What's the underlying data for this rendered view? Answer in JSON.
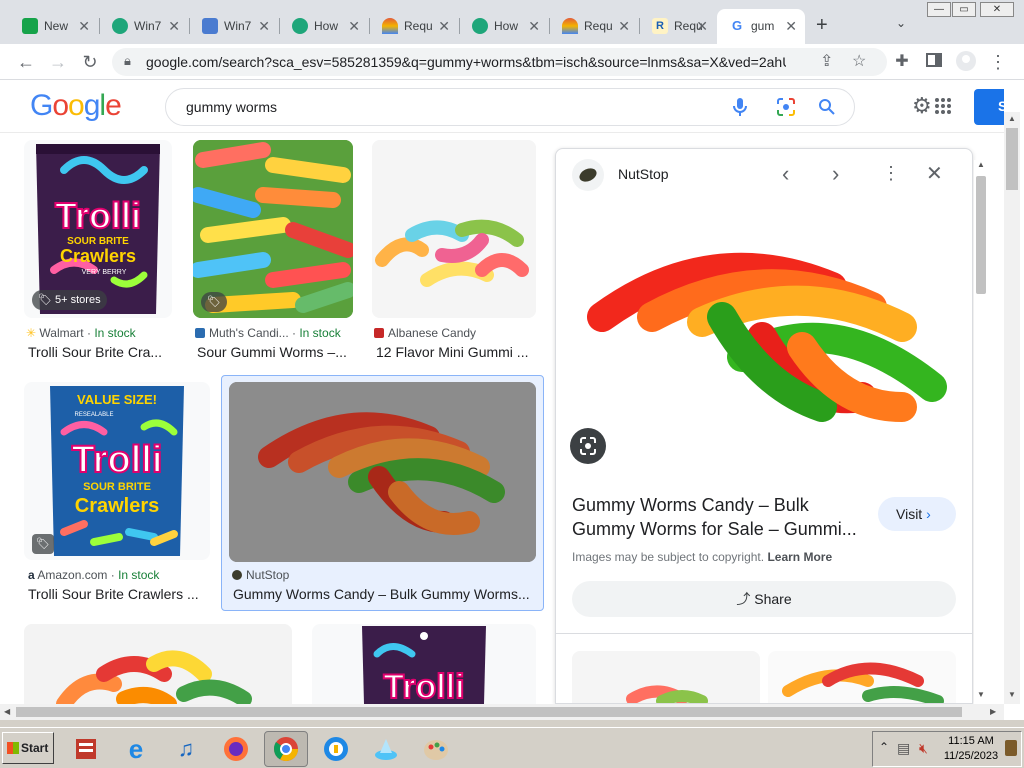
{
  "browser": {
    "tabs": [
      {
        "title": "New",
        "favicon_color": "#16a34a"
      },
      {
        "title": "Win7",
        "favicon_color": "#1ea67a"
      },
      {
        "title": "Win7",
        "favicon_color": "#4a7bd0"
      },
      {
        "title": "How",
        "favicon_color": "#1ea67a"
      },
      {
        "title": "Requ",
        "favicon_color": "#e25b3b"
      },
      {
        "title": "How",
        "favicon_color": "#1ea67a"
      },
      {
        "title": "Requ",
        "favicon_color": "#e25b3b"
      },
      {
        "title": "Requ",
        "favicon_color": "#f4b400"
      },
      {
        "title": "gum",
        "favicon_color": "#4285f4"
      }
    ],
    "new_tab": "+",
    "url": "google.com/search?sca_esv=585281359&q=gummy+worms&tbm=isch&source=lnms&sa=X&ved=2ahU...",
    "window_controls": {
      "minimize": "—",
      "maximize": "▭",
      "close": "✕"
    }
  },
  "google": {
    "query": "gummy worms",
    "sign_in_label": "S"
  },
  "results": [
    {
      "source": "Walmart",
      "stock": "In stock",
      "caption": "Trolli Sour Brite Cra...",
      "badge": "5+ stores"
    },
    {
      "source": "Muth's Candi...",
      "stock": "In stock",
      "caption": "Sour Gummi Worms –..."
    },
    {
      "source": "Albanese Candy",
      "stock": "",
      "caption": "12 Flavor Mini Gummi ..."
    },
    {
      "source": "Amazon.com",
      "stock": "In stock",
      "caption": "Trolli Sour Brite Crawlers ..."
    },
    {
      "source": "NutStop",
      "stock": "",
      "caption": "Gummy Worms Candy – Bulk Gummy Worms..."
    }
  ],
  "panel": {
    "site": "NutStop",
    "title": "Gummy Worms Candy – Bulk Gummy Worms for Sale – Gummi...",
    "visit_label": "Visit",
    "copyright_text": "Images may be subject to copyright.",
    "learn_more": "Learn More",
    "share_label": "Share"
  },
  "product_text": {
    "trolli": "Trolli",
    "sour_brite": "SOUR BRITE",
    "crawlers": "Crawlers",
    "very_berry": "VERY BERRY",
    "value_size": "VALUE SIZE!",
    "resealable": "RESEALABLE"
  },
  "taskbar": {
    "start_label": "Start",
    "time": "11:15 AM",
    "date": "11/25/2023"
  }
}
